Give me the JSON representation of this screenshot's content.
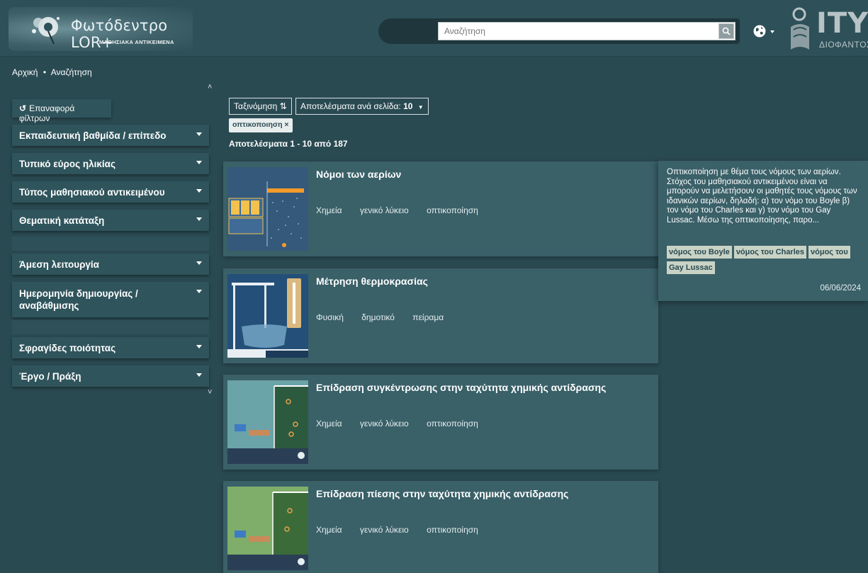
{
  "header": {
    "logo_title": "Φωτόδεντρο LOR+",
    "logo_subtitle": "ΜΑΘΗΣΙΑΚΑ ΑΝΤΙΚΕΙΜΕΝΑ",
    "search_placeholder": "Αναζήτηση",
    "partner_logo_word": "ΙΤΥΕ",
    "partner_logo_sub": "ΔΙΟΦΑΝΤΟΣ",
    "icons": [
      "search-icon",
      "language-globe-icon",
      "chevron-down-icon"
    ]
  },
  "breadcrumb": {
    "home": "Αρχική",
    "separator": "•",
    "current": "Αναζήτηση"
  },
  "sidebar": {
    "reset_label": "Επαναφορά φίλτρων",
    "facets": [
      {
        "label": "Εκπαιδευτική βαθμίδα / επίπεδο"
      },
      {
        "label": "Τυπικό εύρος ηλικίας"
      },
      {
        "label": "Τύπος μαθησιακού αντικειμένου"
      },
      {
        "label": "Θεματική κατάταξη"
      },
      {
        "label": "Άμεση λειτουργία"
      },
      {
        "label": "Ημερομηνία δημιουργίας / αναβάθμισης"
      },
      {
        "label": "Σφραγίδες ποιότητας"
      },
      {
        "label": "Έργο / Πράξη"
      }
    ]
  },
  "toolbar": {
    "sort_label": "Ταξινόμηση",
    "per_page_label": "Αποτελέσματα ανά σελίδα:",
    "per_page_value": "10",
    "active_filter": "οπτικοποιηση ×",
    "results_count": "Αποτελέσματα 1 - 10 από 187"
  },
  "results": [
    {
      "title": "Νόμοι των αερίων",
      "tags": [
        "Χημεία",
        "γενικό λύκειο",
        "οπτικοποίηση"
      ]
    },
    {
      "title": "Μέτρηση θερμοκρασίας",
      "tags": [
        "Φυσική",
        "δημοτικό",
        "πείραμα"
      ]
    },
    {
      "title": "Επίδραση συγκέντρωσης στην ταχύτητα χημικής αντίδρασης",
      "tags": [
        "Χημεία",
        "γενικό λύκειο",
        "οπτικοποίηση"
      ]
    },
    {
      "title": "Επίδραση πίεσης στην ταχύτητα χημικής αντίδρασης",
      "tags": [
        "Χημεία",
        "γενικό λύκειο",
        "οπτικοποίηση"
      ]
    }
  ],
  "popover": {
    "description": "Οπτικοποίηση με θέμα τους νόμους των αερίων. Στόχος του μαθησιακού αντικειμένου είναι να μπορούν να μελετήσουν οι μαθητές τους νόμους των ιδανικών αερίων, δηλαδή: α) τον νόμο του Boyle β) τον νόμο του Charles και γ) τον νόμο του Gay Lussac. Μέσω της οπτικοποίησης, παρο...",
    "keywords": [
      "νόμος του Boyle",
      "νόμος του Charles",
      "νόμος του",
      "Gay Lussac"
    ],
    "date": "06/06/2024"
  },
  "colors": {
    "background": "#2a4a52",
    "panel": "#2f545c",
    "card": "#3a6068",
    "keyword_chip": "#c9d3c5"
  }
}
